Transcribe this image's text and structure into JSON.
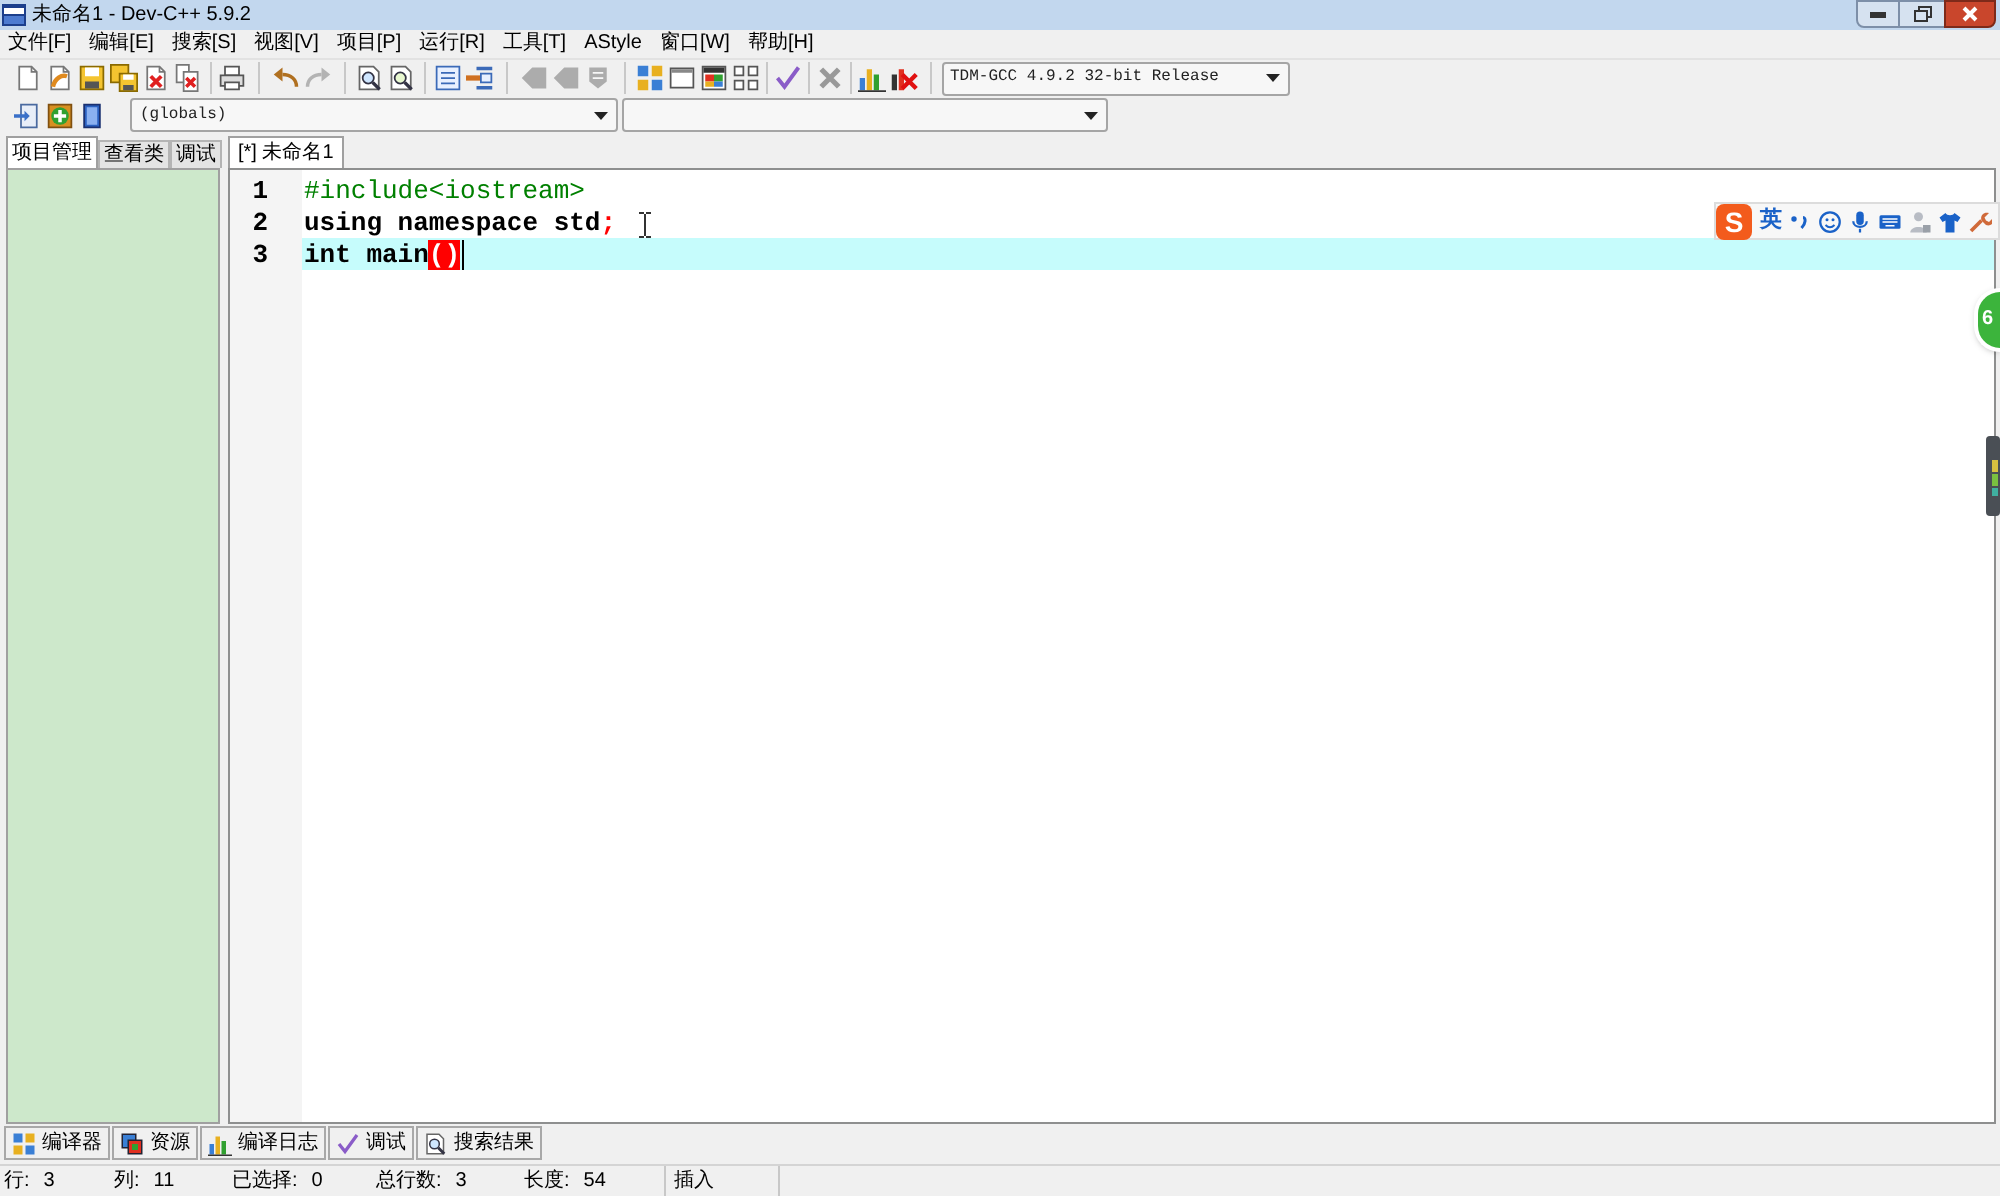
{
  "window": {
    "title": "未命名1 - Dev-C++ 5.9.2"
  },
  "menu": [
    "文件[F]",
    "编辑[E]",
    "搜索[S]",
    "视图[V]",
    "项目[P]",
    "运行[R]",
    "工具[T]",
    "AStyle",
    "窗口[W]",
    "帮助[H]"
  ],
  "toolbar": {
    "groups": [
      [
        {
          "kind": "new",
          "disabled": false
        },
        {
          "kind": "open",
          "disabled": false
        },
        {
          "kind": "save",
          "disabled": false
        },
        {
          "kind": "save_all",
          "disabled": false
        },
        {
          "kind": "close",
          "disabled": false
        },
        {
          "kind": "close_all",
          "disabled": false
        }
      ],
      [
        {
          "kind": "print",
          "disabled": false
        }
      ],
      [
        {
          "kind": "undo",
          "disabled": false
        },
        {
          "kind": "redo",
          "disabled": true
        }
      ],
      [
        {
          "kind": "find",
          "disabled": false
        },
        {
          "kind": "replace",
          "disabled": false
        }
      ],
      [
        {
          "kind": "indent",
          "disabled": false
        },
        {
          "kind": "unindent",
          "disabled": false
        }
      ],
      [
        {
          "kind": "previous",
          "disabled": true
        },
        {
          "kind": "next",
          "disabled": true
        },
        {
          "kind": "bookmark",
          "disabled": true
        }
      ],
      [
        {
          "kind": "compile",
          "disabled": false
        },
        {
          "kind": "run",
          "disabled": false
        },
        {
          "kind": "compile_run",
          "disabled": false
        },
        {
          "kind": "rebuild",
          "disabled": false
        }
      ],
      [
        {
          "kind": "syntax_check",
          "disabled": false
        }
      ],
      [
        {
          "kind": "abort",
          "disabled": true
        }
      ],
      [
        {
          "kind": "profile",
          "disabled": false
        },
        {
          "kind": "delete_profile",
          "disabled": false
        }
      ]
    ],
    "compiler": "TDM-GCC 4.9.2 32-bit Release"
  },
  "class_toolbar": {
    "buttons": [
      {
        "kind": "project_new",
        "disabled": false
      },
      {
        "kind": "project_add",
        "disabled": false
      },
      {
        "kind": "project_options",
        "disabled": false
      }
    ],
    "scope": "(globals)"
  },
  "left_panel": {
    "tabs": [
      {
        "label": "项目管理",
        "selected": true
      },
      {
        "label": "查看类",
        "selected": false
      },
      {
        "label": "调试",
        "selected": false
      }
    ]
  },
  "editor": {
    "tabs": [
      {
        "label": "[*] 未命名1",
        "selected": true
      }
    ],
    "lines": [
      {
        "number": "1",
        "current": false,
        "caret": false,
        "tokens": [
          {
            "kind": "preprocessor",
            "text": "#include<iostream>"
          }
        ]
      },
      {
        "number": "2",
        "current": false,
        "caret": false,
        "tokens": [
          {
            "kind": "keyword",
            "text": "using namespace std"
          },
          {
            "kind": "symbol",
            "text": ";"
          }
        ]
      },
      {
        "number": "3",
        "current": true,
        "caret": true,
        "tokens": [
          {
            "kind": "keyword",
            "text": "int main"
          },
          {
            "kind": "matched_brace",
            "text": "()"
          }
        ]
      }
    ]
  },
  "ime_toolbar": {
    "logo": "S",
    "mode": "英"
  },
  "floating_ball": {
    "text": "6"
  },
  "bottom_tabs": [
    {
      "kind": "compiler",
      "label": "编译器"
    },
    {
      "kind": "resources",
      "label": "资源"
    },
    {
      "kind": "compile_log",
      "label": "编译日志"
    },
    {
      "kind": "debug",
      "label": "调试"
    },
    {
      "kind": "find_results",
      "label": "搜索结果"
    }
  ],
  "status_bar": [
    {
      "label": "行:",
      "value": "3"
    },
    {
      "label": "列:",
      "value": "11"
    },
    {
      "label": "已选择:",
      "value": "0"
    },
    {
      "label": "总行数:",
      "value": "3"
    },
    {
      "label": "长度:",
      "value": "54"
    },
    {
      "label": "插入"
    }
  ]
}
